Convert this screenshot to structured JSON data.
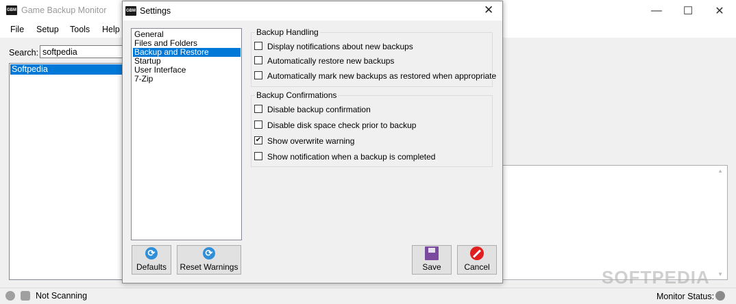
{
  "main_window": {
    "title": "Game Backup Monitor",
    "icon_text": "GBM",
    "minimize_glyph": "—",
    "maximize_glyph": "☐",
    "close_glyph": "✕"
  },
  "menu": [
    "File",
    "Setup",
    "Tools",
    "Help"
  ],
  "search": {
    "label": "Search:",
    "value": "softpedia"
  },
  "game_list": {
    "items": [
      "Softpedia"
    ]
  },
  "statusbar": {
    "scan_status": "Not Scanning",
    "monitor_label": "Monitor Status:"
  },
  "watermark": "SOFTPEDIA",
  "dialog": {
    "title": "Settings",
    "icon_text": "GBM",
    "close_glyph": "✕",
    "categories": [
      "General",
      "Files and Folders",
      "Backup and Restore",
      "Startup",
      "User Interface",
      "7-Zip"
    ],
    "selected_category": "Backup and Restore",
    "backup_handling": {
      "label": "Backup Handling",
      "options": [
        {
          "label": "Display notifications about new backups",
          "checked": false
        },
        {
          "label": "Automatically restore new backups",
          "checked": false
        },
        {
          "label": "Automatically mark new backups as restored when appropriate",
          "checked": false
        }
      ]
    },
    "backup_confirmations": {
      "label": "Backup Confirmations",
      "options": [
        {
          "label": "Disable backup confirmation",
          "checked": false
        },
        {
          "label": "Disable disk space check prior to backup",
          "checked": false
        },
        {
          "label": "Show overwrite warning",
          "checked": true
        },
        {
          "label": "Show notification when a backup is completed",
          "checked": false
        }
      ]
    },
    "buttons": {
      "defaults": "Defaults",
      "reset_warnings": "Reset Warnings",
      "save": "Save",
      "cancel": "Cancel"
    }
  },
  "colors": {
    "selection": "#0078d7",
    "background": "#f0f0f0"
  }
}
